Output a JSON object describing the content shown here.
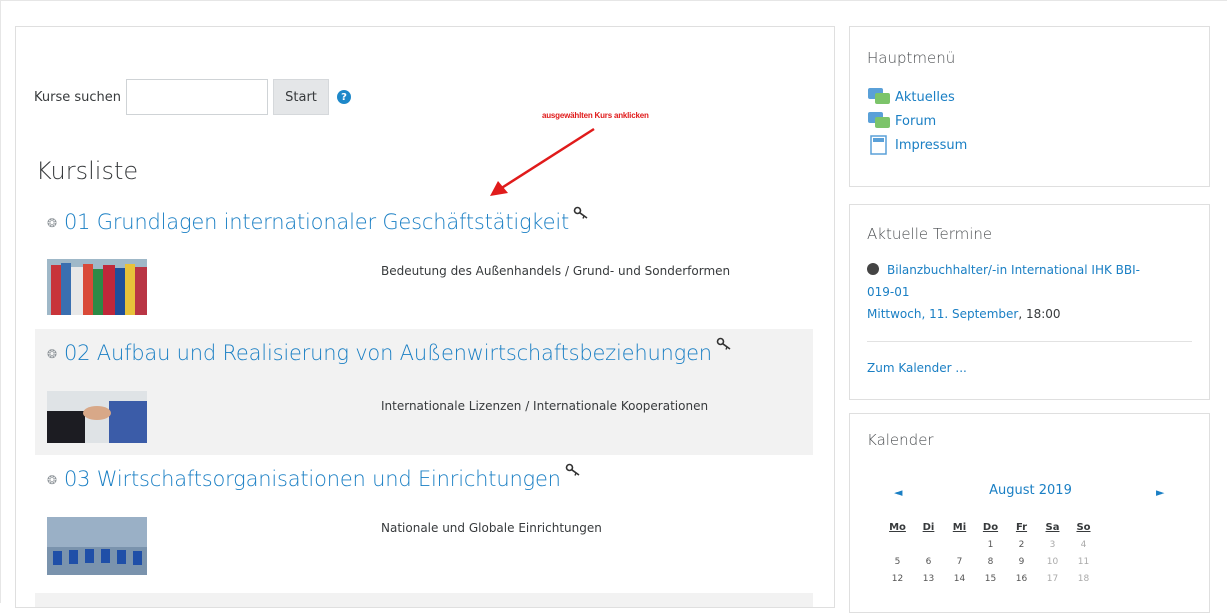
{
  "search": {
    "label": "Kurse suchen",
    "button": "Start",
    "help": "?",
    "value": ""
  },
  "annotation": {
    "text": "ausgewählten Kurs anklicken"
  },
  "page_title": "Kursliste",
  "courses": [
    {
      "title": "01 Grundlagen internationaler Geschäftstätigkeit",
      "summary": "Bedeutung des Außenhandels / Grund- und Sonderformen"
    },
    {
      "title": "02 Aufbau und Realisierung von Außenwirtschaftsbeziehungen",
      "summary": "Internationale Lizenzen / Internationale Kooperationen"
    },
    {
      "title": "03 Wirtschaftsorganisationen und Einrichtungen",
      "summary": "Nationale und Globale Einrichtungen"
    }
  ],
  "main_menu": {
    "title": "Hauptmenü",
    "items": [
      "Aktuelles",
      "Forum",
      "Impressum"
    ]
  },
  "events": {
    "title": "Aktuelle Termine",
    "event_line1": "Bilanzbuchhalter/-in International IHK BBI-",
    "event_line2": "019-01",
    "date_link": "Mittwoch, 11. September",
    "time": ", 18:00",
    "calendar_link": "Zum Kalender ..."
  },
  "calendar": {
    "title": "Kalender",
    "month": "August 2019",
    "prev": "◄",
    "next": "►",
    "weekdays": [
      "Mo",
      "Di",
      "Mi",
      "Do",
      "Fr",
      "Sa",
      "So"
    ],
    "weeks": [
      [
        "",
        "",
        "",
        "1",
        "2",
        "3",
        "4"
      ],
      [
        "5",
        "6",
        "7",
        "8",
        "9",
        "10",
        "11"
      ],
      [
        "12",
        "13",
        "14",
        "15",
        "16",
        "17",
        "18"
      ]
    ]
  },
  "colors": {
    "link": "#1a7fc4",
    "annotation": "#e01b1b",
    "shaded_row": "#f2f2f2"
  }
}
